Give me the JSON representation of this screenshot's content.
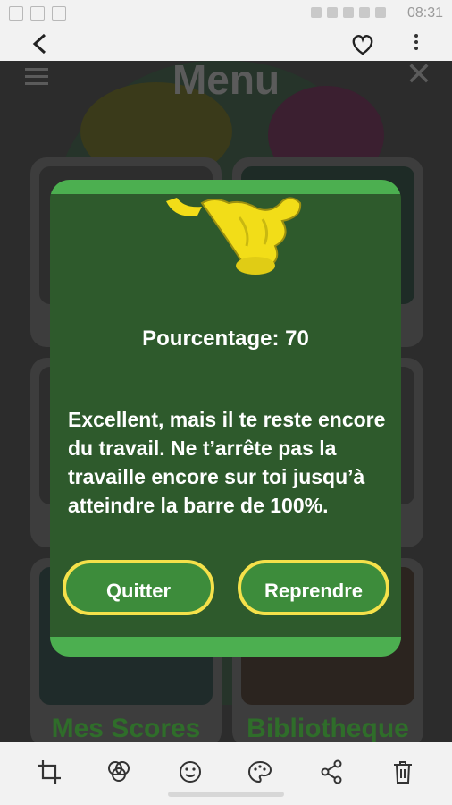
{
  "status_bar": {
    "time": "08:31"
  },
  "viewer": {
    "back_label": "<"
  },
  "app": {
    "title": "Menu",
    "tiles": [
      {
        "label": ""
      },
      {
        "label": ""
      },
      {
        "label": ""
      },
      {
        "label": ""
      },
      {
        "label": "Mes Scores"
      },
      {
        "label": "Bibliotheque"
      }
    ]
  },
  "dialog": {
    "percent_label": "Pourcentage: 70",
    "message": " Excellent, mais il te reste encore du travail. Ne t’arrête pas la travaille encore sur toi jusqu’à atteindre la barre de 100%.",
    "quit_label": "Quitter",
    "resume_label": "Reprendre"
  },
  "colors": {
    "dialog_bg": "#2e5a2c",
    "dialog_accent": "#4caf50",
    "button_border": "#f5e14a",
    "tile_label": "#2f6d2a"
  },
  "icons": {
    "top": [
      "back-icon",
      "heart-icon",
      "more-icon"
    ],
    "bottom": [
      "crop-icon",
      "filter-icon",
      "sticker-icon",
      "palette-icon",
      "share-icon",
      "trash-icon"
    ]
  }
}
